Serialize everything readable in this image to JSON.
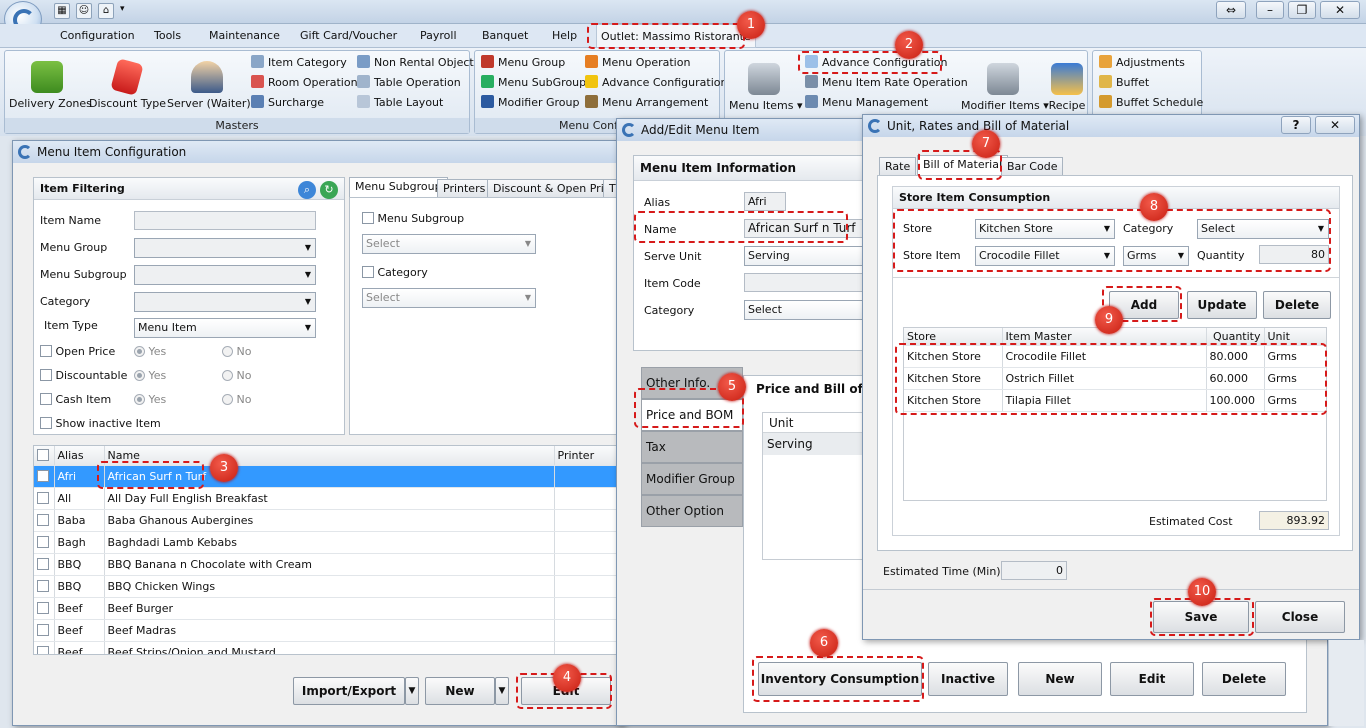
{
  "menubar": {
    "items": [
      "Configuration",
      "Tools",
      "Maintenance",
      "Gift Card/Voucher",
      "Payroll",
      "Banquet",
      "Help",
      "Outlet: Massimo Ristorante"
    ]
  },
  "ribbon": {
    "masters": {
      "caption": "Masters",
      "big": [
        "Delivery Zones",
        "Discount Type",
        "Server (Waiter)"
      ],
      "col1": [
        "Item Category",
        "Room Operation",
        "Surcharge"
      ],
      "col2": [
        "Non Rental Object",
        "Table Operation",
        "Table Layout"
      ]
    },
    "menu_config": {
      "caption": "Menu Configu",
      "col1": [
        "Menu Group",
        "Menu SubGroup",
        "Modifier Group"
      ],
      "col2": [
        "Menu Operation",
        "Advance Configuration",
        "Menu Arrangement"
      ]
    },
    "advance": {
      "menu_items": "Menu Items",
      "links": [
        "Advance Configuration",
        "Menu Item Rate Operation",
        "Menu Management"
      ],
      "modifier_items": "Modifier Items",
      "recipe": "Recipe"
    },
    "buffet": [
      "Adjustments",
      "Buffet",
      "Buffet Schedule"
    ]
  },
  "mic": {
    "title": "Menu Item Configuration",
    "filter_title": "Item Filtering",
    "labels": {
      "item_name": "Item Name",
      "menu_group": "Menu Group",
      "menu_subgroup": "Menu Subgroup",
      "category": "Category",
      "item_type": "Item Type"
    },
    "item_type_value": "Menu Item",
    "flags": [
      "Open Price",
      "Discountable",
      "Cash Item"
    ],
    "yes": "Yes",
    "no": "No",
    "show_inactive": "Show inactive Item",
    "tabs": [
      "Menu Subgroup",
      "Printers",
      "Discount & Open Price",
      "T"
    ],
    "tab_fields": {
      "subgroup": "Menu Subgroup",
      "category": "Category",
      "select": "Select"
    },
    "grid_headers": [
      "Alias",
      "Name",
      "Printer"
    ],
    "rows": [
      [
        "Afri",
        "African Surf n Turf"
      ],
      [
        "All",
        "All Day Full English Breakfast"
      ],
      [
        "Baba",
        "Baba Ghanous Aubergines"
      ],
      [
        "Bagh",
        "Baghdadi Lamb Kebabs"
      ],
      [
        "BBQ",
        "BBQ Banana n Chocolate with Cream"
      ],
      [
        "BBQ",
        "BBQ Chicken Wings"
      ],
      [
        "Beef",
        "Beef Burger"
      ],
      [
        "Beef",
        "Beef Madras"
      ],
      [
        "Beef",
        "Beef Strips/Onion and Mustard"
      ]
    ],
    "buttons": {
      "import": "Import/Export",
      "new": "New",
      "edit": "Edit"
    }
  },
  "edit": {
    "title": "Add/Edit Menu Item",
    "info_title": "Menu Item Information",
    "labels": {
      "alias": "Alias",
      "name": "Name",
      "serve_unit": "Serve Unit",
      "item_code": "Item Code",
      "category": "Category"
    },
    "values": {
      "alias": "Afri",
      "name": "African Surf n Turf",
      "serve_unit": "Serving",
      "category": "Select"
    },
    "side_tabs": [
      "Other Info.",
      "Price and BOM",
      "Tax",
      "Modifier Group",
      "Other Option"
    ],
    "price_title": "Price and Bill of Ma",
    "unit_header": "Unit",
    "unit_value": "Serving",
    "buttons": [
      "Inventory Consumption",
      "Inactive",
      "New",
      "Edit",
      "Delete"
    ]
  },
  "bom": {
    "title": "Unit, Rates and Bill of Material",
    "help": "?",
    "tabs": [
      "Rate",
      "Bill of Material",
      "Bar Code"
    ],
    "section": "Store Item Consumption",
    "labels": {
      "store": "Store",
      "category": "Category",
      "store_item": "Store Item",
      "quantity": "Quantity"
    },
    "values": {
      "store": "Kitchen Store",
      "category": "Select",
      "store_item": "Crocodile Fillet",
      "unit": "Grms",
      "quantity": "80"
    },
    "buttons": {
      "add": "Add",
      "update": "Update",
      "delete": "Delete",
      "save": "Save",
      "close": "Close"
    },
    "headers": [
      "Store",
      "Item Master",
      "Quantity",
      "Unit"
    ],
    "rows": [
      [
        "Kitchen Store",
        "Crocodile Fillet",
        "80.000",
        "Grms"
      ],
      [
        "Kitchen Store",
        "Ostrich Fillet",
        "60.000",
        "Grms"
      ],
      [
        "Kitchen Store",
        "Tilapia Fillet",
        "100.000",
        "Grms"
      ]
    ],
    "est_cost_label": "Estimated Cost",
    "est_cost": "893.92",
    "est_time_label": "Estimated Time (Min)",
    "est_time": "0"
  },
  "callouts": [
    "1",
    "2",
    "3",
    "4",
    "5",
    "6",
    "7",
    "8",
    "9",
    "10"
  ],
  "colors": {
    "highlight": "#d61a1a",
    "selected_row": "#3399ff"
  }
}
